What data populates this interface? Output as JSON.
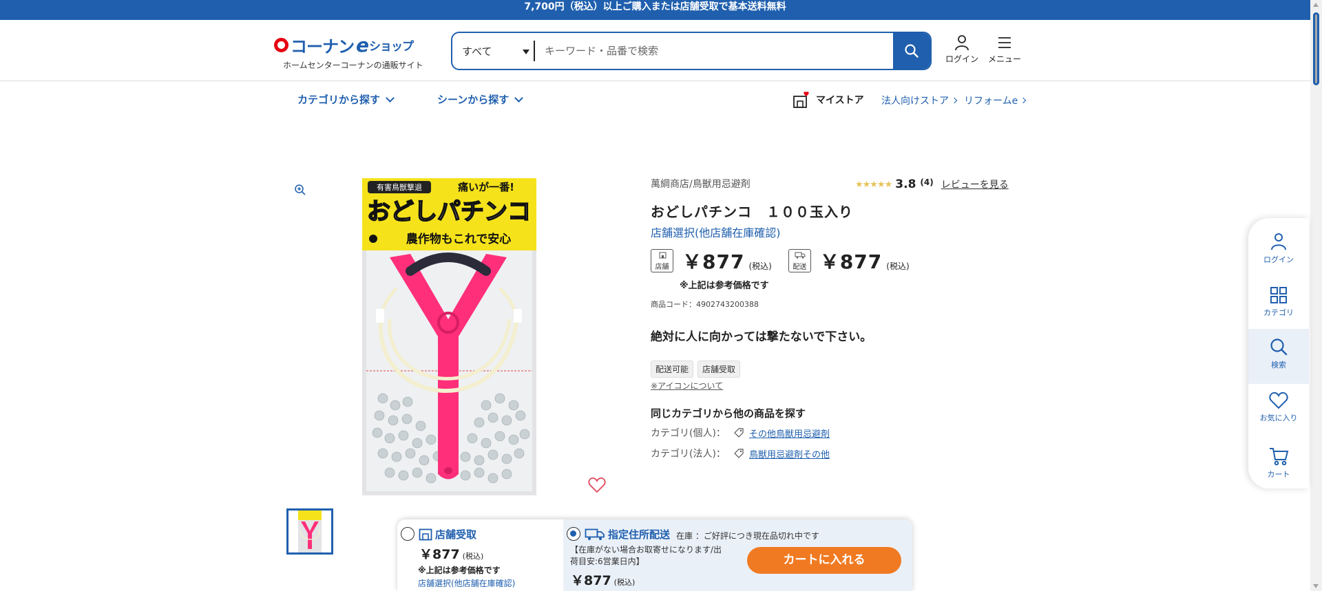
{
  "banner": {
    "text": "7,700円（税込）以上ご購入または店舗受取で基本送料無料"
  },
  "header": {
    "logo_main": "コーナン",
    "logo_e": "e",
    "logo_shop": "ショップ",
    "logo_sub": "ホームセンターコーナンの通販サイト",
    "search_category": "すべて",
    "search_placeholder": "キーワード・品番で検索",
    "login_label": "ログイン",
    "menu_label": "メニュー"
  },
  "nav": {
    "category": "カテゴリから探す",
    "scene": "シーンから探す",
    "mystore": "マイストア",
    "corporate": "法人向けストア",
    "reform": "リフォームe"
  },
  "product": {
    "brand": "萬綱商店/鳥獣用忌避剤",
    "stars": "★★★★★",
    "rating": "3.8",
    "review_count": "(4)",
    "review_link": "レビューを見る",
    "title": "おどしパチンコ　１００玉入り",
    "store_select": "店舗選択(他店舗在庫確認)",
    "store_badge": "店舗",
    "delivery_badge": "配送",
    "store_price": "￥877",
    "delivery_price": "￥877",
    "tax": "(税込)",
    "price_note": "※上記は参考価格です",
    "product_code": "商品コード：4902743200388",
    "warning": "絶対に人に向かっては撃たないで下さい。",
    "tags": [
      "配送可能",
      "店舗受取"
    ],
    "icon_note": "※アイコンについて",
    "category_heading": "同じカテゴリから他の商品を探す",
    "cat_personal_label": "カテゴリ(個人)：",
    "cat_personal_link": "その他鳥獣用忌避剤",
    "cat_corporate_label": "カテゴリ(法人)：",
    "cat_corporate_link": "鳥獣用忌避剤その他"
  },
  "package": {
    "top_left": "有害鳥獣撃退",
    "top_right": "痛いが一番!",
    "main": "おどしパチンコ",
    "sub": "農作物もこれで安心"
  },
  "side_panel": {
    "login": "ログイン",
    "category": "カテゴリ",
    "search": "検索",
    "favorite": "お気に入り",
    "cart": "カート"
  },
  "buy_bar": {
    "pickup_label": "店舗受取",
    "pickup_price": "￥877",
    "pickup_tax": "(税込)",
    "pickup_note": "※上記は参考価格です",
    "pickup_link": "店舗選択(他店舗在庫確認)",
    "delivery_label": "指定住所配送",
    "delivery_status": "在庫 ：ご好評につき現在品切れ中です",
    "delivery_note1": "【在庫がない場合お取寄せになります/出",
    "delivery_note2": "荷目安:6営業日内】",
    "delivery_price": "￥877",
    "delivery_tax": "(税込)",
    "cart_button": "カートに入れる"
  },
  "colors": {
    "brand_blue": "#1f5fae",
    "accent_orange": "#f07a22",
    "logo_red": "#e60012"
  }
}
